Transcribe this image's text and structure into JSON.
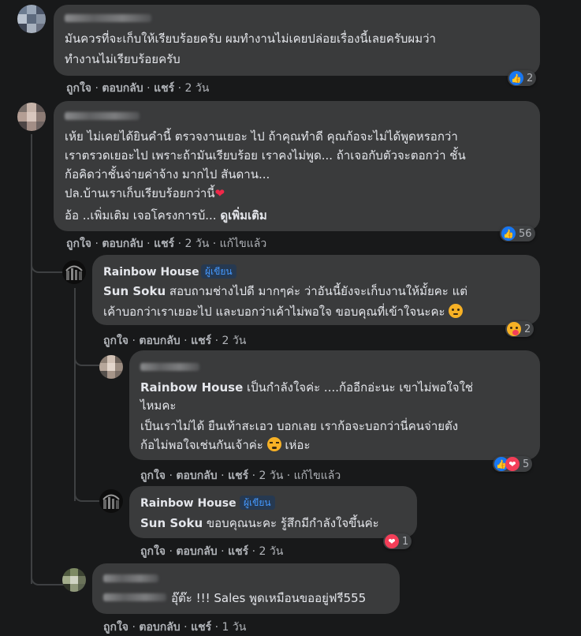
{
  "comments": [
    {
      "text": [
        "มันควรที่จะเก็บให้เรียบร้อยครับ ผมทำงานไม่เคยปล่อยเรื่องนี้เลยครับผมว่า",
        "ทำงานไม่เรียบร้อยครับ"
      ],
      "actions": {
        "like": "ถูกใจ",
        "reply": "ตอบกลับ",
        "share": "แชร์",
        "time": "2 วัน"
      },
      "reactions": {
        "icons": [
          "like-icon"
        ],
        "count": "2"
      }
    },
    {
      "text": [
        "เห้ย ไม่เคยได้ยินคำนี้ ตรวจงานเยอะ ไป ถ้าคุณทำดี คุณก้อจะไม่ได้พูดหรอกว่า",
        "เราตรวดเยอะไป เพราะถ้ามันเรียบร้อย เราคงไม่พูด... ถ้าเจอกับตัวจะตอกว่า ชั้น",
        "ก้อคิดว่าชั้นจ่ายค่าจ้าง มากไป สันดาน...",
        "ปล.บ้านเราเก็บเรียบร้อยกว่านี้",
        "อ้อ ..เพิ่มเติม เจอโครงการบ้..."
      ],
      "see_more": "ดูเพิ่มเติม",
      "actions": {
        "like": "ถูกใจ",
        "reply": "ตอบกลับ",
        "share": "แชร์",
        "time": "2 วัน",
        "edited": "แก้ไขแล้ว"
      },
      "reactions": {
        "icons": [
          "like-icon"
        ],
        "count": "56"
      }
    },
    {
      "author": "Rainbow House",
      "badge": "ผู้เขียน",
      "mention": "Sun Soku",
      "text": [
        " สอบถามช่างไปดี มากๆค่ะ ว่าอันนี้ยังจะเก็บงานให้มั้ยคะ แต่",
        "เค้าบอกว่าเราเยอะไป และบอกว่าเค้าไม่พอใจ ขอบคุณที่เข้าใจนะคะ"
      ],
      "actions": {
        "like": "ถูกใจ",
        "reply": "ตอบกลับ",
        "share": "แชร์",
        "time": "2 วัน"
      },
      "reactions": {
        "icons": [
          "care-icon"
        ],
        "count": "2"
      }
    },
    {
      "mention": "Rainbow House",
      "text": [
        " เป็นกำลังใจค่ะ ....ก้ออีกอ่ะนะ เขาไม่พอใจใช่",
        "ไหมคะ",
        "เป็นเราไม่ได้ ยืนเท้าสะเอว บอกเลย เราก้อจะบอกว่านี่คนจ่ายตัง",
        "ก้อไม่พอใจเช่นกันเจ้าค่ะ",
        "เห่อะ"
      ],
      "actions": {
        "like": "ถูกใจ",
        "reply": "ตอบกลับ",
        "share": "แชร์",
        "time": "2 วัน",
        "edited": "แก้ไขแล้ว"
      },
      "reactions": {
        "icons": [
          "like-icon",
          "love-icon"
        ],
        "count": "5"
      }
    },
    {
      "author": "Rainbow House",
      "badge": "ผู้เขียน",
      "mention": "Sun Soku",
      "text": [
        " ขอบคุณนะคะ รู้สึกมีกำลังใจขึ้นค่ะ"
      ],
      "actions": {
        "like": "ถูกใจ",
        "reply": "ตอบกลับ",
        "share": "แชร์",
        "time": "2 วัน"
      },
      "reactions": {
        "icons": [
          "love-icon"
        ],
        "count": "1"
      }
    },
    {
      "text": [
        "อุ๊ต๊ะ !!! Sales พูดเหมือนขออยู่ฟรี555"
      ],
      "actions": {
        "like": "ถูกใจ",
        "reply": "ตอบกลับ",
        "share": "แชร์",
        "time": "1 วัน"
      }
    }
  ],
  "separator": "·",
  "colors": {
    "background": "#18191a",
    "bubble": "#3a3b3c",
    "text": "#e4e6eb",
    "muted": "#b0b3b8",
    "like": "#1877f2",
    "love": "#f33e58",
    "badge_text": "#4599ff"
  }
}
